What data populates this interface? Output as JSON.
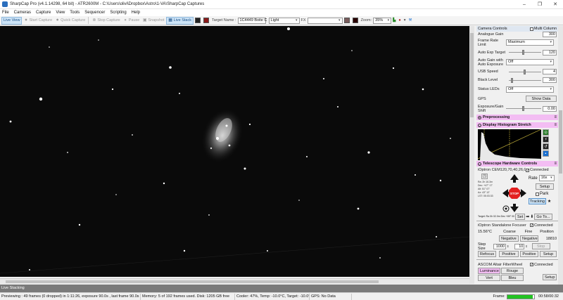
{
  "window": {
    "title": "SharpCap Pro (v4.1.14298, 64 bit) - ATR2600M - C:\\Users\\olivi\\Dropbox\\Astro\\1-VA\\SharpCap Captures",
    "minimize": "–",
    "maximize": "❐",
    "close": "✕"
  },
  "menu": [
    "File",
    "Cameras",
    "Capture",
    "View",
    "Tools",
    "Sequencer",
    "Scripting",
    "Help"
  ],
  "toolbar": {
    "live_view": "Live View",
    "start_capture": "Start Capture",
    "quick_capture": "Quick Capture",
    "stop_capture": "Stop Capture",
    "pause": "Pause",
    "snapshot": "Snapshot",
    "live_stack": "Live Stack",
    "target_label": "Target Name :",
    "target_value": "1C4449 Boite C",
    "profile_value": "Light",
    "fx_label": "FX",
    "zoom_label": "Zoom:",
    "zoom_value": "35%"
  },
  "panel": {
    "camera_controls": {
      "title": "Camera Controls",
      "multi_column": "Multi Column"
    },
    "controls": {
      "analogue_gain": {
        "label": "Analogue Gain",
        "value": "300"
      },
      "frame_rate_limit": {
        "label": "Frame Rate Limit",
        "value": "Maximum"
      },
      "auto_exp_target": {
        "label": "Auto Exp Target",
        "value": "120",
        "level": 0.45
      },
      "auto_gain": {
        "label": "Auto Gain with Auto Exposure",
        "value": "Off"
      },
      "usb_speed": {
        "label": "USB Speed",
        "value": "4",
        "level": 0.5
      },
      "black_level": {
        "label": "Black Level",
        "value": "300",
        "level": 0.1
      },
      "status_leds": {
        "label": "Status LEDs",
        "value": "Off"
      },
      "gps": {
        "label": "GPS",
        "button": "Show Data"
      },
      "exposure_gain_shift": {
        "label": "Exposure/Gain Shift",
        "value": "0.00",
        "level": 0.5
      }
    },
    "preprocessing": {
      "title": "Preprocessing"
    },
    "histogram": {
      "title": "Display Histogram Stretch"
    },
    "telescope": {
      "title": "Telescope Hardware Controls",
      "mount_name": "iOptron CEM120,70,40,26,G",
      "connected": "Connected",
      "readout": [
        "Ra: 2h 16.3m",
        "Dec: +47° 17'",
        "Alt: 51° 07'",
        "Az: 43° 12'",
        "LST: 05:03:33"
      ],
      "stop": "STOP",
      "rate_label": "Rate",
      "rate_value": "16x",
      "setup": "Setup",
      "park": "Park",
      "tracking": "Tracking",
      "set": "Set",
      "goto": "Go To...",
      "target_line": "Target: Ra 0h 02.0m Dec +89° 00'"
    },
    "focuser": {
      "name": "iOptron Standalone Focuser",
      "connected": "Connected",
      "temp": "15.56°C",
      "coarse": "Coarse",
      "fine": "Fine",
      "position_label": "Position",
      "negative1": "Negative",
      "negative2": "Negative",
      "position": "18810",
      "step_label": "Step Size",
      "step_value": "1000",
      "fine_step": "10",
      "stop": "Stop",
      "refocus": "Refocus",
      "positive1": "Positive",
      "positive2": "Positive",
      "setup": "Setup"
    },
    "filterwheel": {
      "name": "ASCOM Altair FilterWheel",
      "connected": "Connected",
      "filters": [
        "Luminance",
        "Rouge",
        "Vert",
        "Bleu"
      ],
      "setup": "Setup"
    }
  },
  "status": {
    "mode": "Live Stacking",
    "previewing": "Previewing : 49 frames (0 dropped) in 1:11:26, exposure 90.0s , last frame 90.0s",
    "memory": "Memory: 5 of 192 frames used. Disk: 1205 GB free",
    "cooler": "Cooler: 47%, Temp: -10.0°C, Target: -10.0°",
    "gps": "GPS: No Data",
    "frame_label": "Frame:",
    "frame_time": "00:58/00:32",
    "frame_progress": 0.95
  },
  "colors": {
    "accent": "#1a6fd0",
    "section": "#f3bdf3",
    "stop": "#e32020",
    "progress": "#22c322"
  }
}
